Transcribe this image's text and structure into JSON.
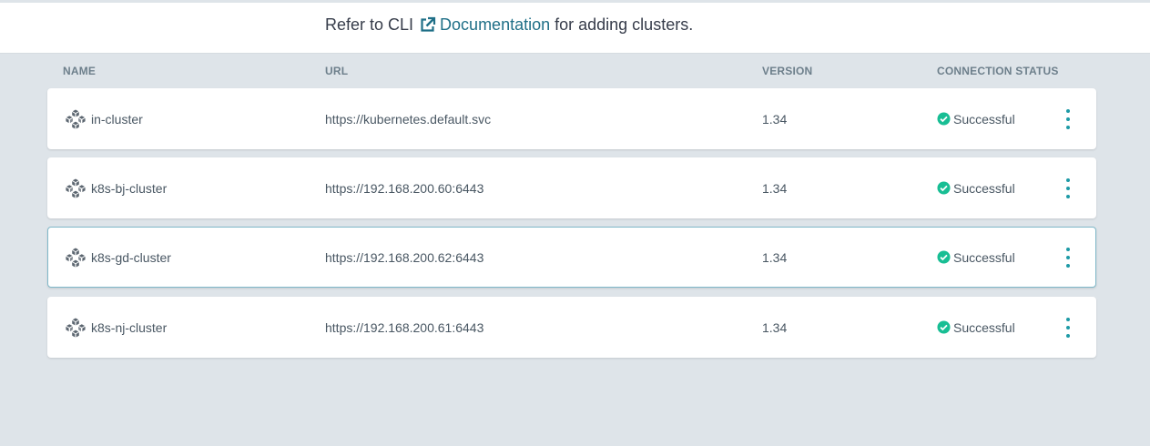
{
  "notice": {
    "before": "Refer to CLI",
    "link_label": "Documentation",
    "after": "for adding clusters.",
    "link_icon": "external-link-icon"
  },
  "columns": {
    "name": "NAME",
    "url": "URL",
    "version": "VERSION",
    "status": "CONNECTION STATUS"
  },
  "clusters": [
    {
      "name": "in-cluster",
      "url": "https://kubernetes.default.svc",
      "version": "1.34",
      "status": "Successful"
    },
    {
      "name": "k8s-bj-cluster",
      "url": "https://192.168.200.60:6443",
      "version": "1.34",
      "status": "Successful"
    },
    {
      "name": "k8s-gd-cluster",
      "url": "https://192.168.200.62:6443",
      "version": "1.34",
      "status": "Successful"
    },
    {
      "name": "k8s-nj-cluster",
      "url": "https://192.168.200.61:6443",
      "version": "1.34",
      "status": "Successful"
    }
  ],
  "icons": {
    "cluster": "cluster-icon",
    "status": "check-circle-icon",
    "menu": "kebab-menu-icon"
  },
  "colors": {
    "accent": "#1d9aa6",
    "link": "#1f6f87",
    "success": "#18be94",
    "background": "#dee4e9",
    "selected_border": "#7fb8c9"
  }
}
